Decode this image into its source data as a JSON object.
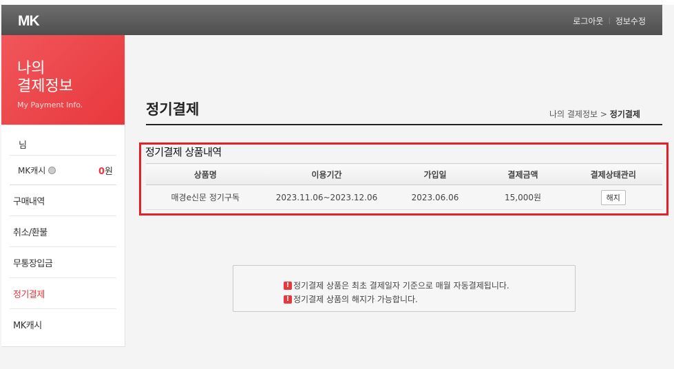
{
  "header": {
    "logo": "MK",
    "logout": "로그아웃",
    "edit_info": "정보수정"
  },
  "sidebar": {
    "banner_title_line1": "나의",
    "banner_title_line2": "결제정보",
    "banner_subtitle": "My Payment Info.",
    "user_suffix": "님",
    "cash_label": "MK캐시",
    "cash_amount": "0",
    "cash_unit": "원",
    "menu": [
      {
        "label": "구매내역"
      },
      {
        "label": "취소/환불"
      },
      {
        "label": "무통장입금"
      },
      {
        "label": "정기결제"
      },
      {
        "label": "MK캐시"
      }
    ]
  },
  "main": {
    "page_title": "정기결제",
    "breadcrumb_parent": "나의 결제정보",
    "breadcrumb_sep": ">",
    "breadcrumb_current": "정기결제",
    "section_title": "정기결제 상품내역",
    "table": {
      "headers": [
        "상품명",
        "이용기간",
        "가입일",
        "결제금액",
        "결제상태관리"
      ],
      "rows": [
        {
          "product": "매경e신문 정기구독",
          "period": "2023.11.06~2023.12.06",
          "joined": "2023.06.06",
          "amount": "15,000원",
          "action": "해지"
        }
      ]
    },
    "notices": [
      "정기결제 상품은 최초 결제일자 기준으로 매월 자동결제됩니다.",
      "정기결제 상품의 해지가 가능합니다."
    ],
    "notice_icon": "!"
  },
  "colors": {
    "accent": "#e8383d",
    "header_bg": "#5a5a5a",
    "highlight_box": "#e61e26"
  }
}
